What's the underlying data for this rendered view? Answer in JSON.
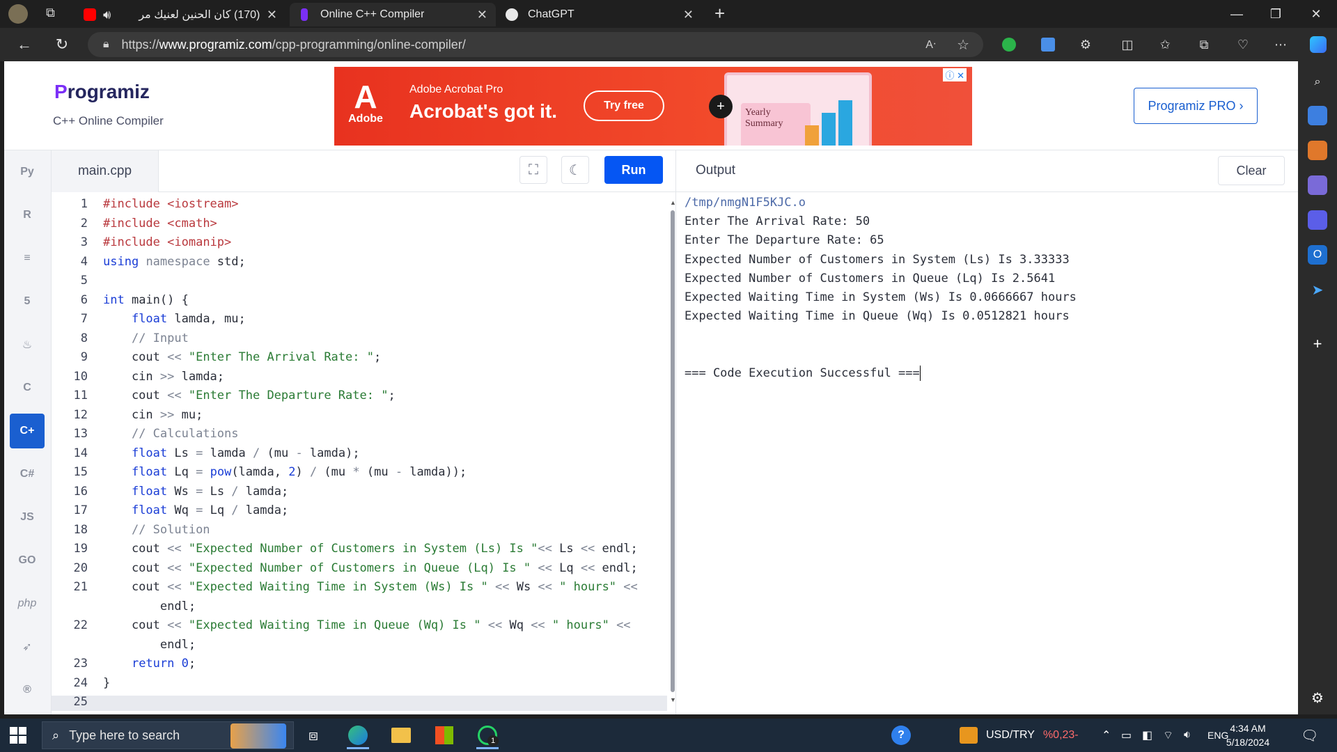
{
  "browser": {
    "tabs": [
      {
        "title": "(170) كان الحنين لعنيك مر",
        "active": false
      },
      {
        "title": "Online C++ Compiler",
        "active": true
      },
      {
        "title": "ChatGPT",
        "active": false
      }
    ],
    "new_tab": "+",
    "url_prefix": "https://",
    "url_domain": "www.programiz.com",
    "url_path": "/cpp-programming/online-compiler/"
  },
  "header": {
    "logo_text": "rogramiz",
    "logo_letter": "P",
    "subtitle": "C++ Online Compiler",
    "pro_button": "Programiz PRO ›"
  },
  "ad": {
    "brand_glyph": "A",
    "brand_word": "Adobe",
    "product": "Adobe Acrobat Pro",
    "headline": "Acrobat's got it.",
    "cta": "Try free",
    "plus": "+",
    "doc_line1": "Yearly",
    "doc_line2": "Summary",
    "close": "ⓘ ✕"
  },
  "languages": [
    {
      "label": "Py",
      "name": "python"
    },
    {
      "label": "R",
      "name": "r"
    },
    {
      "label": "≡",
      "name": "sql"
    },
    {
      "label": "5",
      "name": "html"
    },
    {
      "label": "♨",
      "name": "java"
    },
    {
      "label": "C",
      "name": "c"
    },
    {
      "label": "C+",
      "name": "cpp",
      "active": true
    },
    {
      "label": "C#",
      "name": "csharp"
    },
    {
      "label": "JS",
      "name": "javascript"
    },
    {
      "label": "GO",
      "name": "go"
    },
    {
      "label": "php",
      "name": "php"
    },
    {
      "label": "➶",
      "name": "swift"
    },
    {
      "label": "®",
      "name": "rust"
    }
  ],
  "editor": {
    "filename": "main.cpp",
    "run_label": "Run",
    "lines": [
      {
        "n": "1",
        "html": "<span class=\"hd\">#include</span> <span class=\"hd\">&lt;iostream&gt;</span>"
      },
      {
        "n": "2",
        "html": "<span class=\"hd\">#include</span> <span class=\"hd\">&lt;cmath&gt;</span>"
      },
      {
        "n": "3",
        "html": "<span class=\"hd\">#include</span> <span class=\"hd\">&lt;iomanip&gt;</span>"
      },
      {
        "n": "4",
        "html": "<span class=\"kw\">using</span> <span class=\"cm\">namespace</span> std;"
      },
      {
        "n": "5",
        "html": ""
      },
      {
        "n": "6",
        "html": "<span class=\"kw\">int</span> main() {"
      },
      {
        "n": "7",
        "html": "    <span class=\"kw\">float</span> lamda, mu;"
      },
      {
        "n": "8",
        "html": "    <span class=\"cm\">// Input</span>"
      },
      {
        "n": "9",
        "html": "    cout <span class=\"op\">&lt;&lt;</span> <span class=\"str\">\"Enter The Arrival Rate: \"</span>;"
      },
      {
        "n": "10",
        "html": "    cin <span class=\"op\">&gt;&gt;</span> lamda;"
      },
      {
        "n": "11",
        "html": "    cout <span class=\"op\">&lt;&lt;</span> <span class=\"str\">\"Enter The Departure Rate: \"</span>;"
      },
      {
        "n": "12",
        "html": "    cin <span class=\"op\">&gt;&gt;</span> mu;"
      },
      {
        "n": "13",
        "html": "    <span class=\"cm\">// Calculations</span>"
      },
      {
        "n": "14",
        "html": "    <span class=\"kw\">float</span> Ls <span class=\"op\">=</span> lamda <span class=\"op\">/</span> (mu <span class=\"op\">-</span> lamda);"
      },
      {
        "n": "15",
        "html": "    <span class=\"kw\">float</span> Lq <span class=\"op\">=</span> <span class=\"kw\">pow</span>(lamda, <span class=\"nm\">2</span>) <span class=\"op\">/</span> (mu <span class=\"op\">*</span> (mu <span class=\"op\">-</span> lamda));"
      },
      {
        "n": "16",
        "html": "    <span class=\"kw\">float</span> Ws <span class=\"op\">=</span> Ls <span class=\"op\">/</span> lamda;"
      },
      {
        "n": "17",
        "html": "    <span class=\"kw\">float</span> Wq <span class=\"op\">=</span> Lq <span class=\"op\">/</span> lamda;"
      },
      {
        "n": "18",
        "html": "    <span class=\"cm\">// Solution</span>"
      },
      {
        "n": "19",
        "html": "    cout <span class=\"op\">&lt;&lt;</span> <span class=\"str\">\"Expected Number of Customers in System (Ls) Is \"</span><span class=\"op\">&lt;&lt;</span> Ls <span class=\"op\">&lt;&lt;</span> endl;"
      },
      {
        "n": "20",
        "html": "    cout <span class=\"op\">&lt;&lt;</span> <span class=\"str\">\"Expected Number of Customers in Queue (Lq) Is \"</span> <span class=\"op\">&lt;&lt;</span> Lq <span class=\"op\">&lt;&lt;</span> endl;"
      },
      {
        "n": "21",
        "html": "    cout <span class=\"op\">&lt;&lt;</span> <span class=\"str\">\"Expected Waiting Time in System (Ws) Is \"</span> <span class=\"op\">&lt;&lt;</span> Ws <span class=\"op\">&lt;&lt;</span> <span class=\"str\">\" hours\"</span> <span class=\"op\">&lt;&lt;</span>"
      },
      {
        "n": "",
        "html": "        endl;"
      },
      {
        "n": "22",
        "html": "    cout <span class=\"op\">&lt;&lt;</span> <span class=\"str\">\"Expected Waiting Time in Queue (Wq) Is \"</span> <span class=\"op\">&lt;&lt;</span> Wq <span class=\"op\">&lt;&lt;</span> <span class=\"str\">\" hours\"</span> <span class=\"op\">&lt;&lt;</span>"
      },
      {
        "n": "",
        "html": "        endl;"
      },
      {
        "n": "23",
        "html": "    <span class=\"kw\">return</span> <span class=\"nm\">0</span>;"
      },
      {
        "n": "24",
        "html": "}"
      },
      {
        "n": "25",
        "html": ""
      }
    ]
  },
  "output": {
    "title": "Output",
    "clear_label": "Clear",
    "lines": [
      "/tmp/nmgN1F5KJC.o",
      "Enter The Arrival Rate: 50",
      "Enter The Departure Rate: 65",
      "Expected Number of Customers in System (Ls) Is 3.33333",
      "Expected Number of Customers in Queue (Lq) Is 2.5641",
      "Expected Waiting Time in System (Ws) Is 0.0666667 hours",
      "Expected Waiting Time in Queue (Wq) Is 0.0512821 hours",
      "",
      "",
      "=== Code Execution Successful ==="
    ]
  },
  "taskbar": {
    "search_placeholder": "Type here to search",
    "ticker_label": "USD/TRY",
    "ticker_value": "%0,23-",
    "language": "ENG",
    "time": "4:34 AM",
    "date": "5/18/2024",
    "whatsapp_badge": "1"
  }
}
